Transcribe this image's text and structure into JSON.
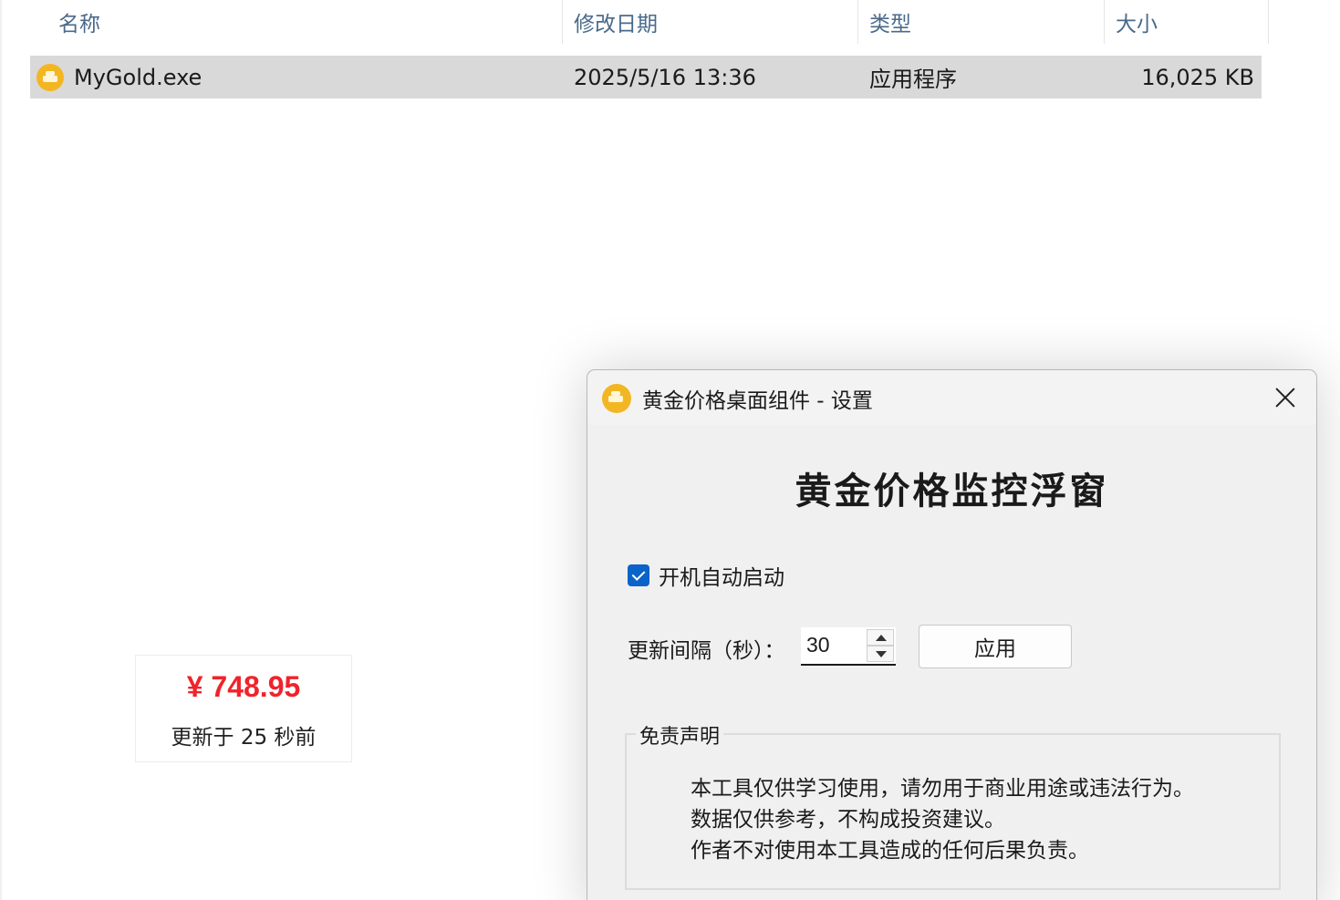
{
  "explorer": {
    "columns": {
      "name": "名称",
      "modified": "修改日期",
      "type": "类型",
      "size": "大小"
    },
    "rows": [
      {
        "name": "MyGold.exe",
        "modified": "2025/5/16 13:36",
        "type": "应用程序",
        "size": "16,025 KB",
        "icon": "gold-app-icon"
      }
    ],
    "selected_row_color": "#d9d9d9"
  },
  "widget": {
    "price": "¥ 748.95",
    "updated": "更新于 25 秒前",
    "price_color": "#f0232b"
  },
  "dialog": {
    "title": "黄金价格桌面组件 - 设置",
    "heading": "黄金价格监控浮窗",
    "autostart": {
      "label": "开机自动启动",
      "checked": true
    },
    "interval": {
      "label": "更新间隔（秒）：",
      "value": "30"
    },
    "apply_label": "应用",
    "disclaimer": {
      "title": "免责声明",
      "lines": [
        "本工具仅供学习使用，请勿用于商业用途或违法行为。",
        "数据仅供参考，不构成投资建议。",
        "作者不对使用本工具造成的任何后果负责。"
      ]
    },
    "accent_color": "#0a63c8"
  }
}
